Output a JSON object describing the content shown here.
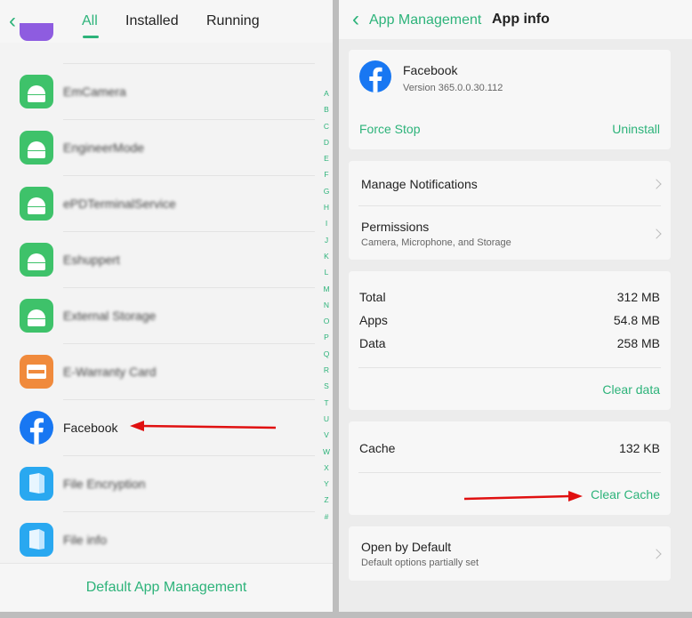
{
  "left": {
    "tabs": [
      "All",
      "Installed",
      "Running"
    ],
    "apps": [
      {
        "label": "EmCamera",
        "icon": "android-icon",
        "obscured": true
      },
      {
        "label": "EngineerMode",
        "icon": "android-icon",
        "obscured": true
      },
      {
        "label": "ePDTerminalService",
        "icon": "android-icon",
        "obscured": true
      },
      {
        "label": "Eshuppert",
        "icon": "android-icon",
        "obscured": true
      },
      {
        "label": "External Storage",
        "icon": "android-icon",
        "obscured": true
      },
      {
        "label": "E-Warranty Card",
        "icon": "card-icon",
        "obscured": true
      },
      {
        "label": "Facebook",
        "icon": "facebook-icon",
        "obscured": false
      },
      {
        "label": "File Encryption",
        "icon": "file-icon",
        "obscured": true
      },
      {
        "label": "File info",
        "icon": "file-icon",
        "obscured": true
      }
    ],
    "alphabet": [
      "A",
      "B",
      "C",
      "D",
      "E",
      "F",
      "G",
      "H",
      "I",
      "J",
      "K",
      "L",
      "M",
      "N",
      "O",
      "P",
      "Q",
      "R",
      "S",
      "T",
      "U",
      "V",
      "W",
      "X",
      "Y",
      "Z",
      "#"
    ],
    "bottom_button": "Default App Management"
  },
  "right": {
    "back_label": "App Management",
    "title": "App info",
    "app_name": "Facebook",
    "version": "Version 365.0.0.30.112",
    "force_stop": "Force Stop",
    "uninstall": "Uninstall",
    "manage_notifications": "Manage Notifications",
    "permissions_title": "Permissions",
    "permissions_sub": "Camera, Microphone, and Storage",
    "storage": [
      {
        "label": "Total",
        "value": "312 MB"
      },
      {
        "label": "Apps",
        "value": "54.8 MB"
      },
      {
        "label": "Data",
        "value": "258 MB"
      }
    ],
    "clear_data": "Clear data",
    "cache_label": "Cache",
    "cache_value": "132 KB",
    "clear_cache": "Clear Cache",
    "open_default_title": "Open by Default",
    "open_default_sub": "Default options partially set"
  },
  "colors": {
    "accent": "#2db37a",
    "arrow": "#e01010",
    "facebook": "#1877f2"
  }
}
